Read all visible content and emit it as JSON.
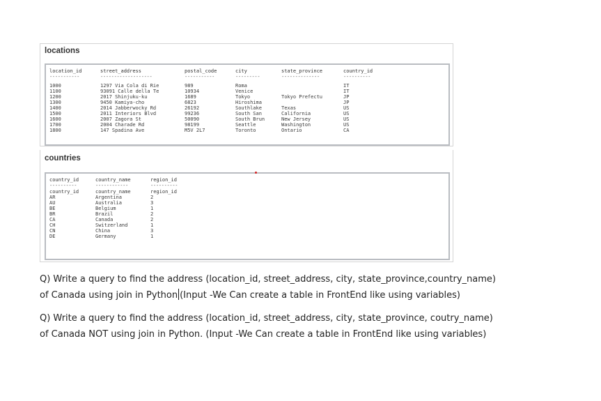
{
  "locations": {
    "title": "locations",
    "columns": [
      "location_id",
      "street_address",
      "postal_code",
      "city",
      "state_province",
      "country_id"
    ],
    "dashes": [
      "-----------",
      "-------------------",
      "-----------",
      "---------",
      "--------------",
      "----------"
    ],
    "rows": [
      [
        "1000",
        "1297 Via Cola di Rie",
        "989",
        "Roma",
        "",
        "IT"
      ],
      [
        "1100",
        "93091 Calle della Te",
        "10934",
        "Venice",
        "",
        "IT"
      ],
      [
        "1200",
        "2017 Shinjuku-ku",
        "1689",
        "Tokyo",
        "Tokyo Prefectu",
        "JP"
      ],
      [
        "1300",
        "9450 Kamiya-cho",
        "6823",
        "Hiroshima",
        "",
        "JP"
      ],
      [
        "1400",
        "2014 Jabberwocky Rd",
        "26192",
        "Southlake",
        "Texas",
        "US"
      ],
      [
        "1500",
        "2011 Interiors Blvd",
        "99236",
        "South San",
        "California",
        "US"
      ],
      [
        "1600",
        "2007 Zagora St",
        "50090",
        "South Brun",
        "New Jersey",
        "US"
      ],
      [
        "1700",
        "2004 Charade Rd",
        "98199",
        "Seattle",
        "Washington",
        "US"
      ],
      [
        "1800",
        "147 Spadina Ave",
        "M5V 2L7",
        "Toronto",
        "Ontario",
        "CA"
      ]
    ]
  },
  "countries": {
    "title": "countries",
    "columns": [
      "country_id",
      "country_name",
      "region_id"
    ],
    "dashes": [
      "----------",
      "------------",
      "----------"
    ],
    "rows": [
      [
        "country_id",
        "country_name",
        "region_id"
      ],
      [
        "AR",
        "Argentina",
        "2"
      ],
      [
        "AU",
        "Australia",
        "3"
      ],
      [
        "BE",
        "Belgium",
        "1"
      ],
      [
        "BR",
        "Brazil",
        "2"
      ],
      [
        "CA",
        "Canada",
        "2"
      ],
      [
        "CH",
        "Switzerland",
        "1"
      ],
      [
        "CN",
        "China",
        "3"
      ],
      [
        "DE",
        "Germany",
        "1"
      ]
    ]
  },
  "questions": [
    {
      "line1": "Q) Write a query to find the address (location_id, street_address, city, state_province,country_name)",
      "line2_before_caret": "of Canada using join in Python",
      "line2_after_caret": "(Input -We Can create a table in FrontEnd like using variables)"
    },
    {
      "line1": "Q) Write a query to find the address (location_id, street_address, city, state_province, coutry_name)",
      "line2_before_caret": "of Canada NOT using join in Python. (Input -We Can create a table in FrontEnd like using variables)",
      "line2_after_caret": ""
    }
  ],
  "colors": {
    "grid_border": "#b9bcc1",
    "panel_border": "#d4d4d4",
    "dot": "#d42020"
  }
}
